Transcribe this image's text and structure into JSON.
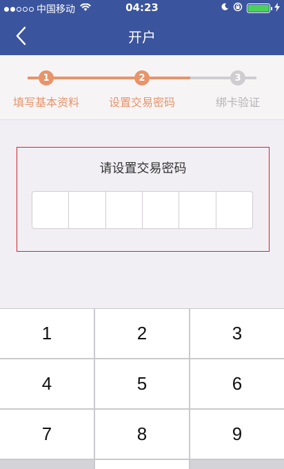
{
  "status_bar": {
    "carrier": "中国移动",
    "time": "04:23",
    "battery_level": 1.0
  },
  "nav": {
    "title": "开户"
  },
  "steps": [
    {
      "number": "1",
      "label": "填写基本资料"
    },
    {
      "number": "2",
      "label": "设置交易密码"
    },
    {
      "number": "3",
      "label": "绑卡验证"
    }
  ],
  "password": {
    "title": "请设置交易密码",
    "length": 6
  },
  "keypad": {
    "keys": [
      "1",
      "2",
      "3",
      "4",
      "5",
      "6",
      "7",
      "8",
      "9"
    ]
  },
  "colors": {
    "nav": "#3b549e",
    "step_active": "#e8946a",
    "step_inactive": "#cfcdd0",
    "highlight_border": "#d8202a"
  }
}
